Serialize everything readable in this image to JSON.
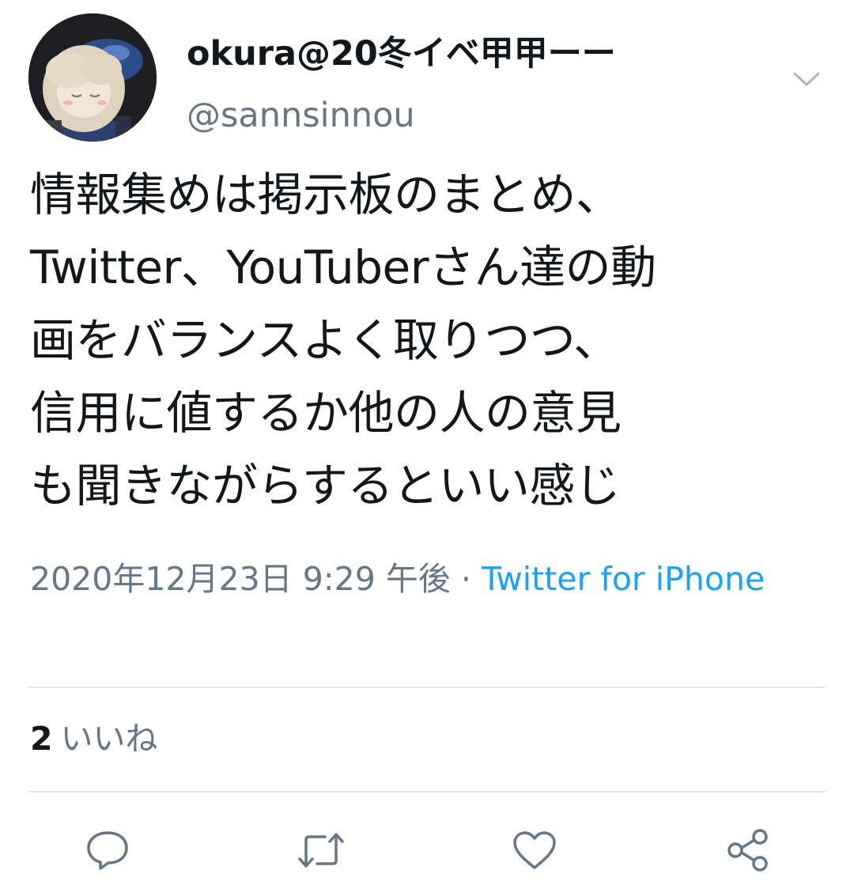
{
  "author": {
    "display_name": "okura@20冬イベ甲甲ーー",
    "handle": "@sannsinnou",
    "avatar_icon": "avatar-figure-image"
  },
  "tweet": {
    "lines": [
      "情報集めは掲示板のまとめ、",
      "Twitter、YouTuberさん達の動",
      "画をバランスよく取りつつ、",
      "信用に値するか他の人の意見",
      "も聞きながらするといい感じ"
    ]
  },
  "meta": {
    "timestamp": "2020年12月23日 9:29 午後",
    "separator": " · ",
    "source": "Twitter for iPhone"
  },
  "stats": {
    "likes_count": "2",
    "likes_label": "いいね"
  },
  "actions": {
    "reply_icon": "reply-icon",
    "retweet_icon": "retweet-icon",
    "like_icon": "heart-icon",
    "share_icon": "share-icon",
    "menu_icon": "chevron-down-icon"
  },
  "colors": {
    "text": "#14171a",
    "secondary": "#657786",
    "link": "#1da1f2",
    "divider": "#e1e8ed"
  }
}
